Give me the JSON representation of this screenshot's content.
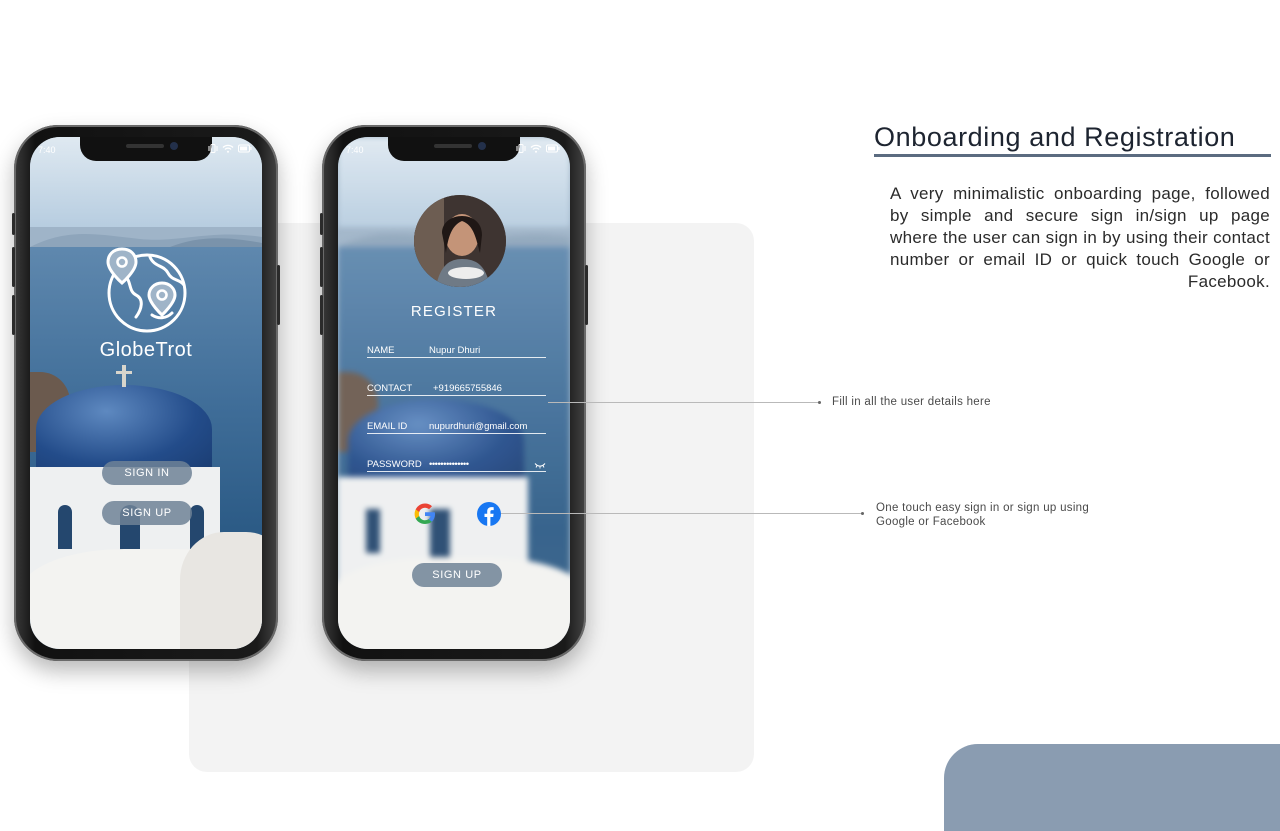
{
  "page": {
    "title": "Onboarding and Registration",
    "description": "A very minimalistic onboarding page, followed by simple and secure sign in/sign up page where the user can sign in by using their contact number or email ID or quick touch Google or Facebook."
  },
  "callouts": {
    "fill_details": "Fill in all the user details here",
    "social": "One touch easy sign in or sign up using Google or Facebook"
  },
  "phone_onboarding": {
    "status_time": "7:40",
    "app_name": "GlobeTrot",
    "logo_icon": "globe-with-pins-icon",
    "sign_in_label": "SIGN IN",
    "sign_up_label": "SIGN UP"
  },
  "phone_register": {
    "status_time": "7:40",
    "heading": "REGISTER",
    "fields": {
      "name": {
        "label": "NAME",
        "value": "Nupur Dhuri"
      },
      "contact": {
        "label": "CONTACT",
        "value": "+919665755846"
      },
      "email": {
        "label": "EMAIL ID",
        "value": "nupurdhuri@gmail.com"
      },
      "password": {
        "label": "PASSWORD",
        "value": "••••••••••••••"
      }
    },
    "social_icons": [
      "google-icon",
      "facebook-icon"
    ],
    "sign_up_label": "SIGN UP"
  },
  "colors": {
    "accent": "#8a9cb1",
    "title_underline": "#5b6b80",
    "button": "#6e8296"
  }
}
